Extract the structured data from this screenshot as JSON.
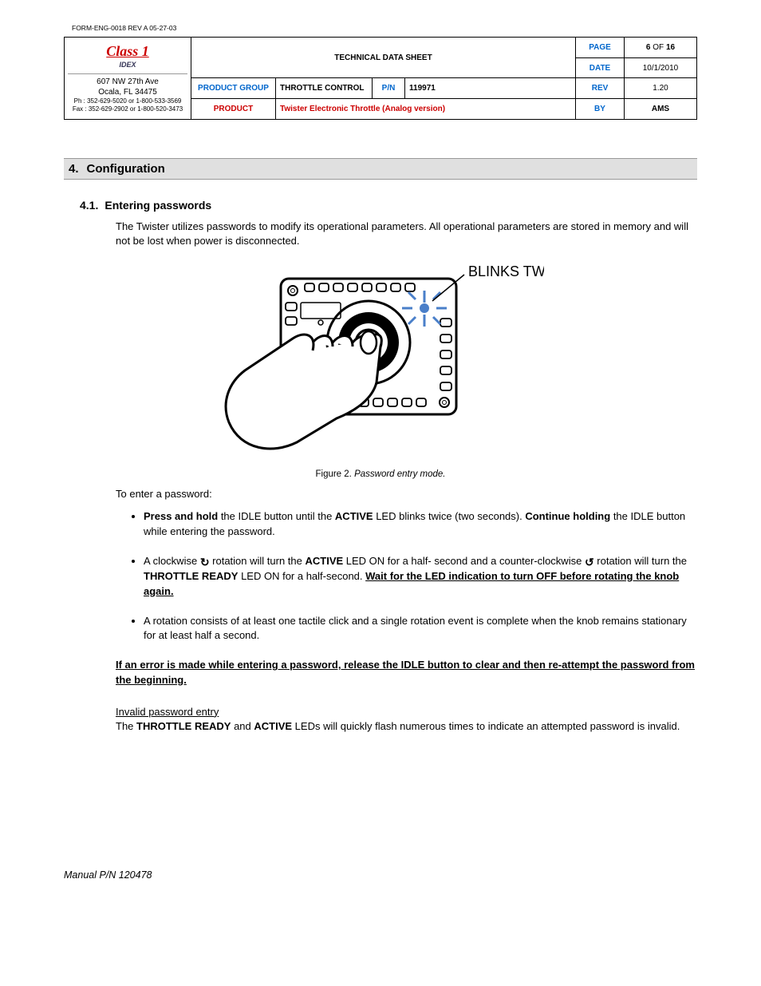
{
  "form_id": "FORM-ENG-0018  REV A   05-27-03",
  "logo": {
    "brand": "Class 1",
    "sub": "IDEX",
    "addr1": "607 NW 27th Ave",
    "addr2": "Ocala, FL 34475",
    "phone": "Ph : 352-629-5020 or 1-800-533-3569",
    "fax": "Fax : 352-629-2902 or 1-800-520-3473"
  },
  "header": {
    "title": "TECHNICAL DATA SHEET",
    "page_label": "PAGE",
    "page_value_prefix": "6",
    "page_value_of": " OF ",
    "page_value_suffix": "16",
    "date_label": "DATE",
    "date_value": "10/1/2010",
    "group_label": "PRODUCT GROUP",
    "group_value": "THROTTLE CONTROL",
    "pn_label": "P/N",
    "pn_value": "119971",
    "rev_label": "REV",
    "rev_value": "1.20",
    "product_label": "PRODUCT",
    "product_value": "Twister Electronic Throttle (Analog version)",
    "by_label": "BY",
    "by_value": "AMS"
  },
  "section": {
    "num": "4.",
    "title": "Configuration"
  },
  "subsection": {
    "num": "4.1.",
    "title": "Entering passwords"
  },
  "para1": "The Twister utilizes passwords to modify its operational parameters.  All operational parameters are stored in memory and will not be lost when power is disconnected.",
  "figure": {
    "label": "Figure 2.",
    "text": "Password entry mode.",
    "annotation": "BLINKS TWICE"
  },
  "para2": "To enter a password:",
  "steps": {
    "s1": {
      "a": "Press and hold",
      "b": " the IDLE button until the ",
      "c": "ACTIVE",
      "d": " LED blinks twice (two seconds).  ",
      "e": "Continue holding",
      "f": " the IDLE button while entering the password."
    },
    "s2": {
      "a": "A clockwise ",
      "cw": "↻",
      "b": " rotation will turn the ",
      "c": "ACTIVE",
      "d": " LED ON for a half- second and a counter-clockwise ",
      "ccw": "↺",
      "e": " rotation will turn the ",
      "f": "THROTTLE READY",
      "g": " LED ON for a half-second.  ",
      "h": "Wait for the LED indication to turn OFF before rotating the knob again."
    },
    "s3": "A rotation consists of at least one tactile click and a single rotation event is complete when the knob remains stationary for at least half a second."
  },
  "error_note": "If an error is made while entering a password, release the IDLE button to clear and then re-attempt the password from the beginning.",
  "invalid": {
    "heading": "Invalid password entry",
    "a": "The ",
    "b": "THROTTLE READY",
    "c": " and ",
    "d": "ACTIVE",
    "e": " LEDs will quickly flash numerous times to indicate an attempted password is invalid."
  },
  "footer": "Manual P/N 120478"
}
